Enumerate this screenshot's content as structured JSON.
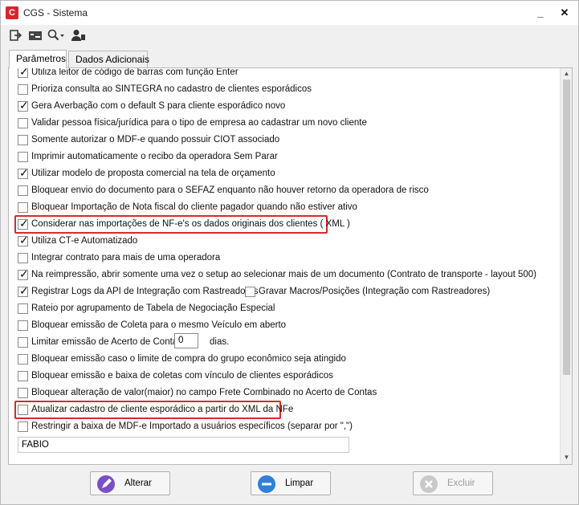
{
  "window": {
    "title": "CGS - Sistema"
  },
  "titlebar": {
    "minimize": "_",
    "close": "✕"
  },
  "toolbar": {
    "icons": [
      "exit-icon",
      "card-icon",
      "search-icon",
      "user-icon"
    ]
  },
  "tabs": [
    {
      "label": "Parâmetros",
      "active": true
    },
    {
      "label": "Dados Adicionais",
      "active": false
    }
  ],
  "options": [
    {
      "label": "Utiliza leitor de código de barras com função Enter",
      "checked": true
    },
    {
      "label": "Prioriza consulta ao SINTEGRA no cadastro de clientes esporádicos",
      "checked": false
    },
    {
      "label": "Gera Averbação com o default S para cliente esporádico novo",
      "checked": true
    },
    {
      "label": "Validar pessoa física/jurídica para o tipo de empresa ao cadastrar um novo cliente",
      "checked": false
    },
    {
      "label": "Somente autorizar o MDF-e quando possuir CIOT associado",
      "checked": false
    },
    {
      "label": "Imprimir automaticamente o recibo da operadora Sem Parar",
      "checked": false
    },
    {
      "label": "Utilizar modelo de proposta comercial na tela de orçamento",
      "checked": true
    },
    {
      "label": "Bloquear envio do documento para o SEFAZ  enquanto não houver retorno da operadora de risco",
      "checked": false
    },
    {
      "label": "Bloquear Importação de Nota fiscal do cliente pagador quando não estiver ativo",
      "checked": false
    },
    {
      "label": "Considerar nas importações de NF-e's os dados originais dos clientes ( XML )",
      "checked": true
    },
    {
      "label": "Utiliza CT-e Automatizado",
      "checked": true
    },
    {
      "label": "Integrar contrato para mais de uma operadora",
      "checked": false
    },
    {
      "label": "Na reimpressão, abrir somente uma vez o setup ao selecionar mais de um documento (Contrato de transporte - layout 500)",
      "checked": true
    },
    {
      "label": "Registrar Logs da API de Integração com Rastreadores",
      "checked": true
    },
    {
      "label": "Rateio por agrupamento de Tabela de Negociação Especial",
      "checked": false
    },
    {
      "label": "Bloquear emissão de Coleta para o mesmo Veículo em aberto",
      "checked": false
    },
    {
      "label": "Limitar emissão de Acerto de Contas à",
      "checked": false
    },
    {
      "label": "Bloquear emissão caso o limite de compra do grupo econômico seja atingido",
      "checked": false
    },
    {
      "label": "Bloquear emissão e baixa de coletas com vínculo de clientes esporádicos",
      "checked": false
    },
    {
      "label": "Bloquear alteração de valor(maior) no campo Frete Combinado no Acerto de Contas",
      "checked": false
    },
    {
      "label": "Atualizar cadastro de cliente esporádico a partir do XML da NFe",
      "checked": false
    },
    {
      "label": "Restringir a baixa de MDF-e Importado a usuários específicos (separar por \",\")",
      "checked": false
    }
  ],
  "gravar_macros": {
    "label": "Gravar Macros/Posições (Integração com Rastreadores)",
    "checked": false
  },
  "acerto_dias": {
    "value": "0",
    "suffix": "dias."
  },
  "usuarios_input": {
    "value": "FABIO"
  },
  "buttons": {
    "alterar": "Alterar",
    "limpar": "Limpar",
    "excluir": "Excluir"
  }
}
